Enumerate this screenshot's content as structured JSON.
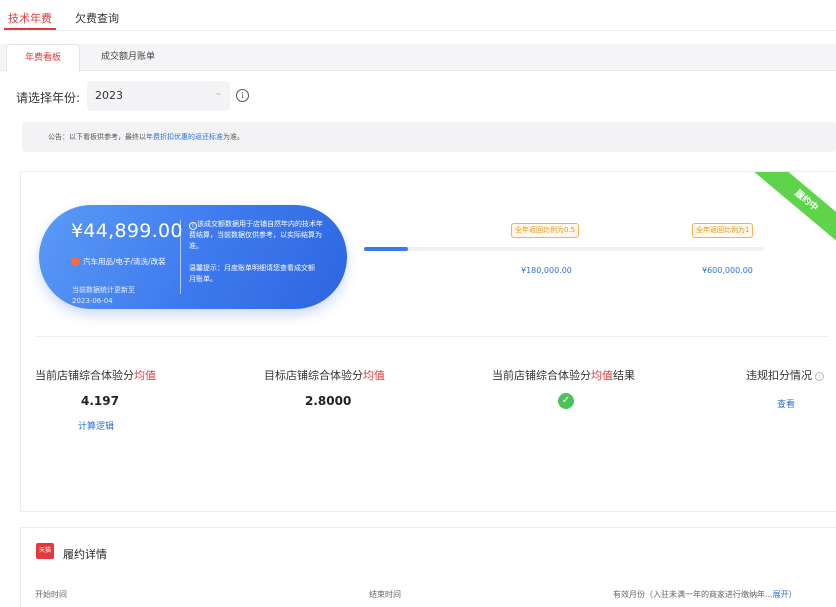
{
  "top_tabs": [
    {
      "label": "技术年费",
      "active": true
    },
    {
      "label": "欠费查询",
      "active": false
    }
  ],
  "sub_tabs": [
    {
      "label": "年费看板",
      "active": true
    },
    {
      "label": "成交额月账单",
      "active": false
    }
  ],
  "year_selector": {
    "label": "请选择年份:",
    "value": "2023"
  },
  "notice": {
    "prefix": "公告：以下看板供参考，最终以",
    "link": "年费折扣优惠的返还标准",
    "suffix": "为准。"
  },
  "status_ribbon": "履约中",
  "summary": {
    "amount": "¥44,899.00",
    "category": "汽车用品/电子/清洗/改装",
    "update_note": "当前数据统计更新至",
    "update_date": "2023-06-04",
    "info_text": "该成交额数据用于店铺自然年内的技术年费结算，当前数据仅供参考，以实际结算为准。",
    "tip_text": "温馨提示：月度账单明细请您查看成交额月账单。"
  },
  "progress": {
    "fraction": 0.11,
    "milestones": [
      {
        "label": "全年返回比例为0.5",
        "value": "¥180,000.00"
      },
      {
        "label": "全年返回比例为1",
        "value": "¥600,000.00"
      }
    ]
  },
  "stats": {
    "current": {
      "title_pre": "当前店铺综合体验分",
      "title_em": "均值",
      "title_post": "",
      "value": "4.197",
      "link": "计算逻辑"
    },
    "target": {
      "title_pre": "目标店铺综合体验分",
      "title_em": "均值",
      "title_post": "",
      "value": "2.8000"
    },
    "result": {
      "title_pre": "当前店铺综合体验分",
      "title_em": "均值",
      "title_post": "结果"
    },
    "violation": {
      "title": "违规扣分情况",
      "link": "查看"
    }
  },
  "detail": {
    "logo_text": "天猫",
    "title": "履约详情",
    "columns": {
      "start": "开始时间",
      "end": "结束时间",
      "months": "有效月份（入驻未满一年的商家进行缴纳年...",
      "expand": "展开",
      "close_paren": "）"
    }
  },
  "colors": {
    "accent": "#e4393c",
    "link": "#2d6fdc",
    "pill": "#3d79ee",
    "success": "#4cc05a"
  }
}
